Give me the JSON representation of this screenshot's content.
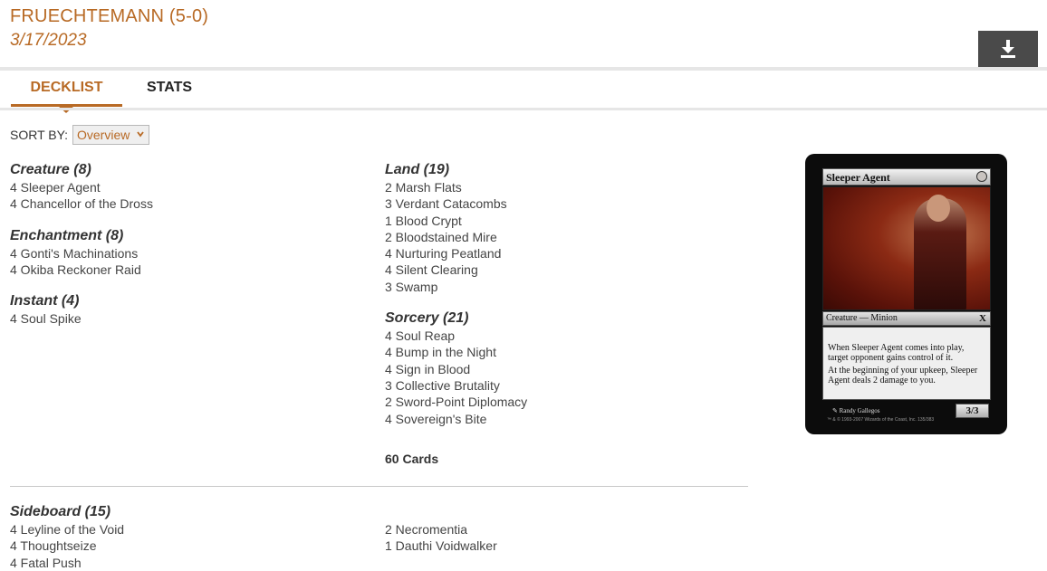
{
  "header": {
    "player": "FRUECHTEMANN (5-0)",
    "date": "3/17/2023",
    "download_icon": "download-icon"
  },
  "tabs": [
    {
      "label": "DECKLIST",
      "active": true
    },
    {
      "label": "STATS",
      "active": false
    }
  ],
  "sort": {
    "label": "SORT BY:",
    "selected": "Overview"
  },
  "accent_color": "#b86a25",
  "maindeck": {
    "left_column": [
      {
        "title": "Creature (8)",
        "cards": [
          "4 Sleeper Agent",
          "4 Chancellor of the Dross"
        ]
      },
      {
        "title": "Enchantment (8)",
        "cards": [
          "4 Gonti's Machinations",
          "4 Okiba Reckoner Raid"
        ]
      },
      {
        "title": "Instant (4)",
        "cards": [
          "4 Soul Spike"
        ]
      }
    ],
    "right_column": [
      {
        "title": "Land (19)",
        "cards": [
          "2 Marsh Flats",
          "3 Verdant Catacombs",
          "1 Blood Crypt",
          "2 Bloodstained Mire",
          "4 Nurturing Peatland",
          "4 Silent Clearing",
          "3 Swamp"
        ]
      },
      {
        "title": "Sorcery (21)",
        "cards": [
          "4 Soul Reap",
          "4 Bump in the Night",
          "4 Sign in Blood",
          "3 Collective Brutality",
          "2 Sword-Point Diplomacy",
          "4 Sovereign's Bite"
        ]
      }
    ],
    "total": "60 Cards"
  },
  "sideboard": {
    "title": "Sideboard (15)",
    "left_cards": [
      "4 Leyline of the Void",
      "4 Thoughtseize",
      "4 Fatal Push"
    ],
    "right_cards": [
      "2 Necromentia",
      "1 Dauthi Voidwalker"
    ]
  },
  "card_preview": {
    "name": "Sleeper Agent",
    "type_line": "Creature — Minion",
    "set_symbol": "X",
    "rules_text": [
      "When Sleeper Agent comes into play, target opponent gains control of it.",
      "At the beginning of your upkeep, Sleeper Agent deals 2 damage to you."
    ],
    "power_toughness": "3/3",
    "artist": "Randy Gallegos",
    "copyright": "™ & © 1993-2007 Wizards of the Coast, Inc. 135/383"
  }
}
